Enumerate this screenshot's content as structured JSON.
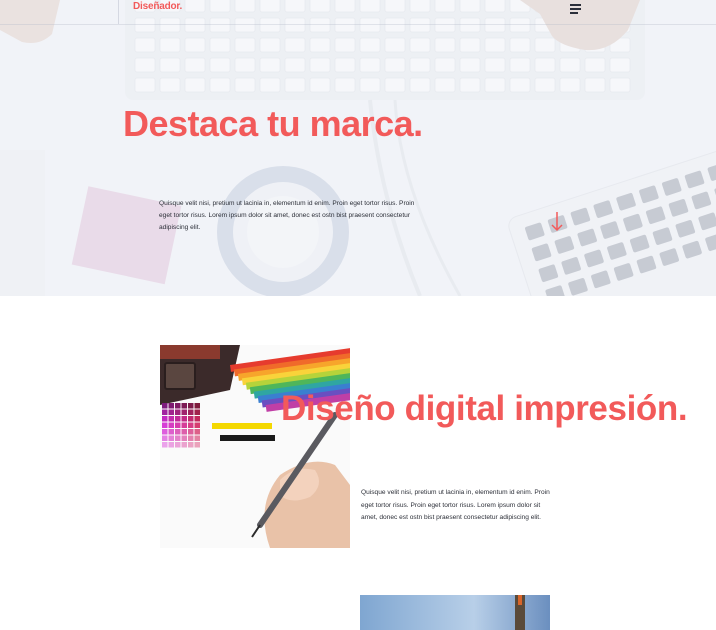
{
  "theme": {
    "accent": "#f25a5a"
  },
  "header": {
    "brand": "Diseñador.",
    "menu_icon": "hamburger-menu-icon"
  },
  "hero": {
    "title": "Destaca tu marca.",
    "text": "Quisque velit nisi, pretium ut lacinia in, elementum id enim. Proin eget tortor risus. Proin eget tortor risus. Lorem ipsum dolor sit amet, donec est ostn bist praesent consectetur adipiscing elit.",
    "scroll_icon": "arrow-down-icon"
  },
  "design_section": {
    "title": "Diseño digital impresión.",
    "text": "Quisque velit nisi, pretium ut lacinia in, elementum id enim. Proin eget tortor risus. Proin eget tortor risus. Lorem ipsum dolor sit amet, donec est ostn bist praesent consectetur adipiscing elit."
  }
}
